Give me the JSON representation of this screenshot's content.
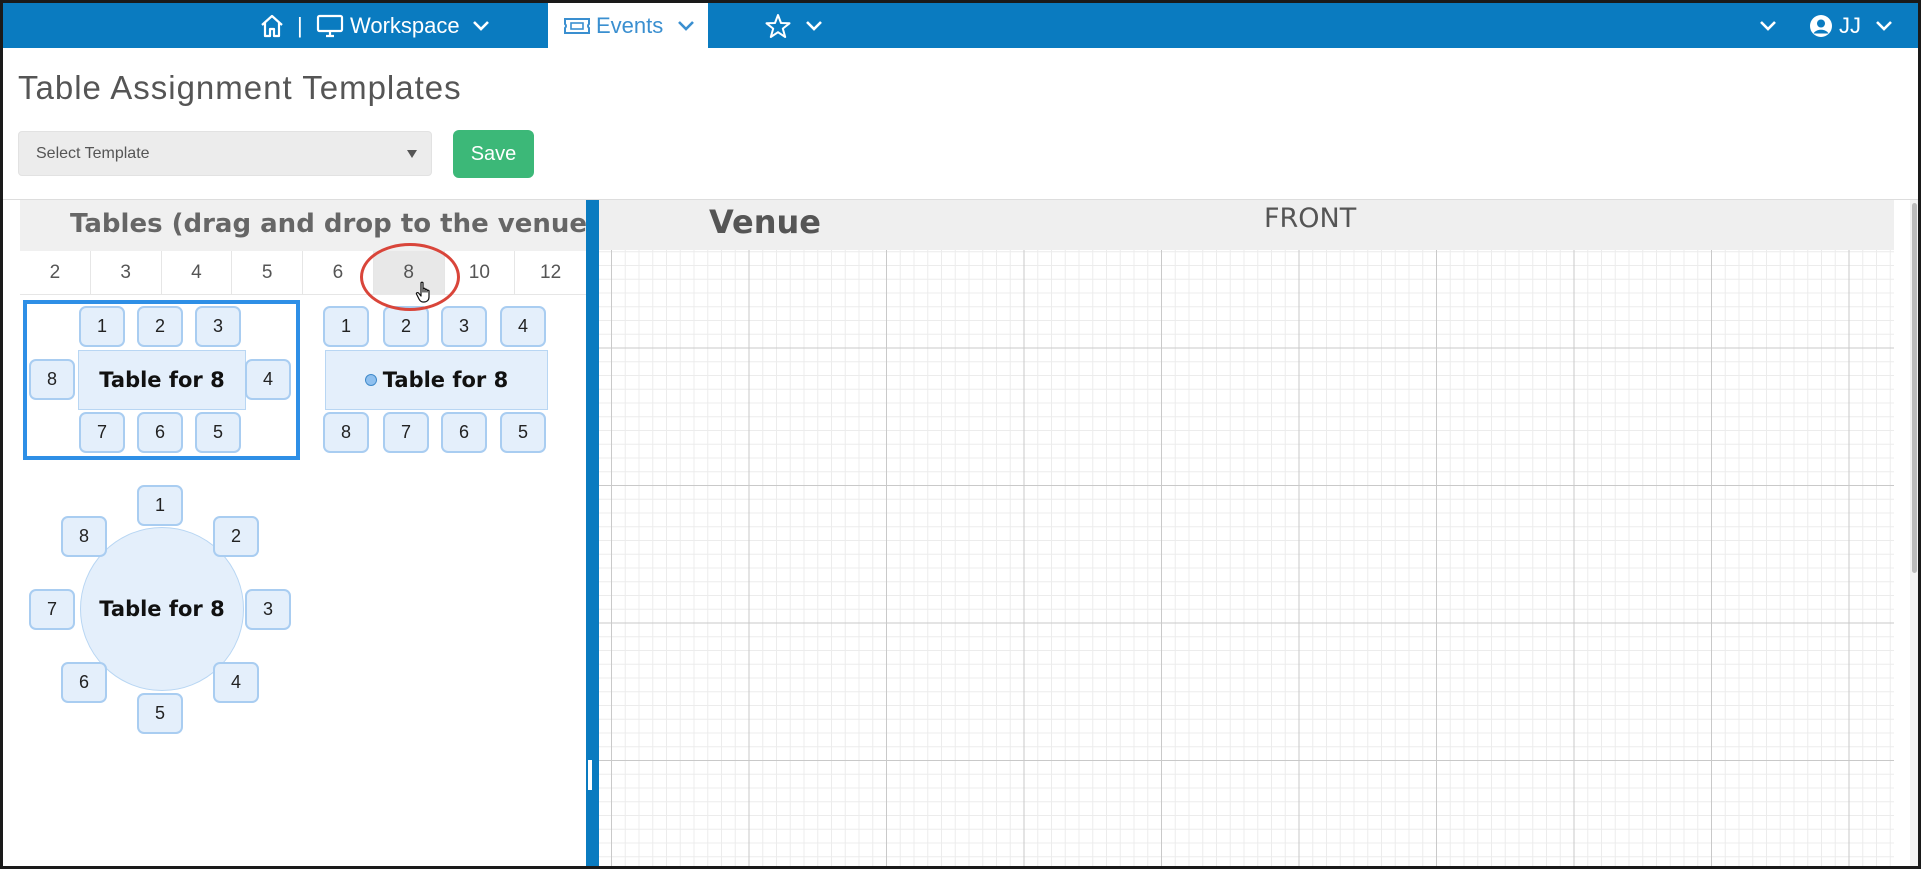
{
  "nav": {
    "workspace_label": "Workspace",
    "events_label": "Events",
    "separator": "|",
    "user_label": "JJ"
  },
  "page": {
    "title": "Table Assignment Templates",
    "select_placeholder": "Select Template",
    "save_label": "Save"
  },
  "palette": {
    "title": "Tables (drag and drop to the venue palette)",
    "size_tabs": [
      "2",
      "3",
      "4",
      "5",
      "6",
      "8",
      "10",
      "12"
    ],
    "active_size": "8",
    "tables": [
      {
        "label": "Table for 8",
        "seats": [
          "1",
          "2",
          "3",
          "4",
          "5",
          "6",
          "7",
          "8"
        ]
      },
      {
        "label": "Table for 8",
        "seats": [
          "1",
          "2",
          "3",
          "4",
          "5",
          "6",
          "7",
          "8"
        ]
      },
      {
        "label": "Table for 8",
        "seats": [
          "1",
          "2",
          "3",
          "4",
          "5",
          "6",
          "7",
          "8"
        ]
      }
    ]
  },
  "venue": {
    "title": "Venue",
    "front_label": "FRONT"
  },
  "colors": {
    "nav_bar": "#0a7bc0",
    "save_button": "#3cb878",
    "selection": "#2e8fe6",
    "seat_fill": "#e4effb",
    "highlight": "#d9453a"
  }
}
